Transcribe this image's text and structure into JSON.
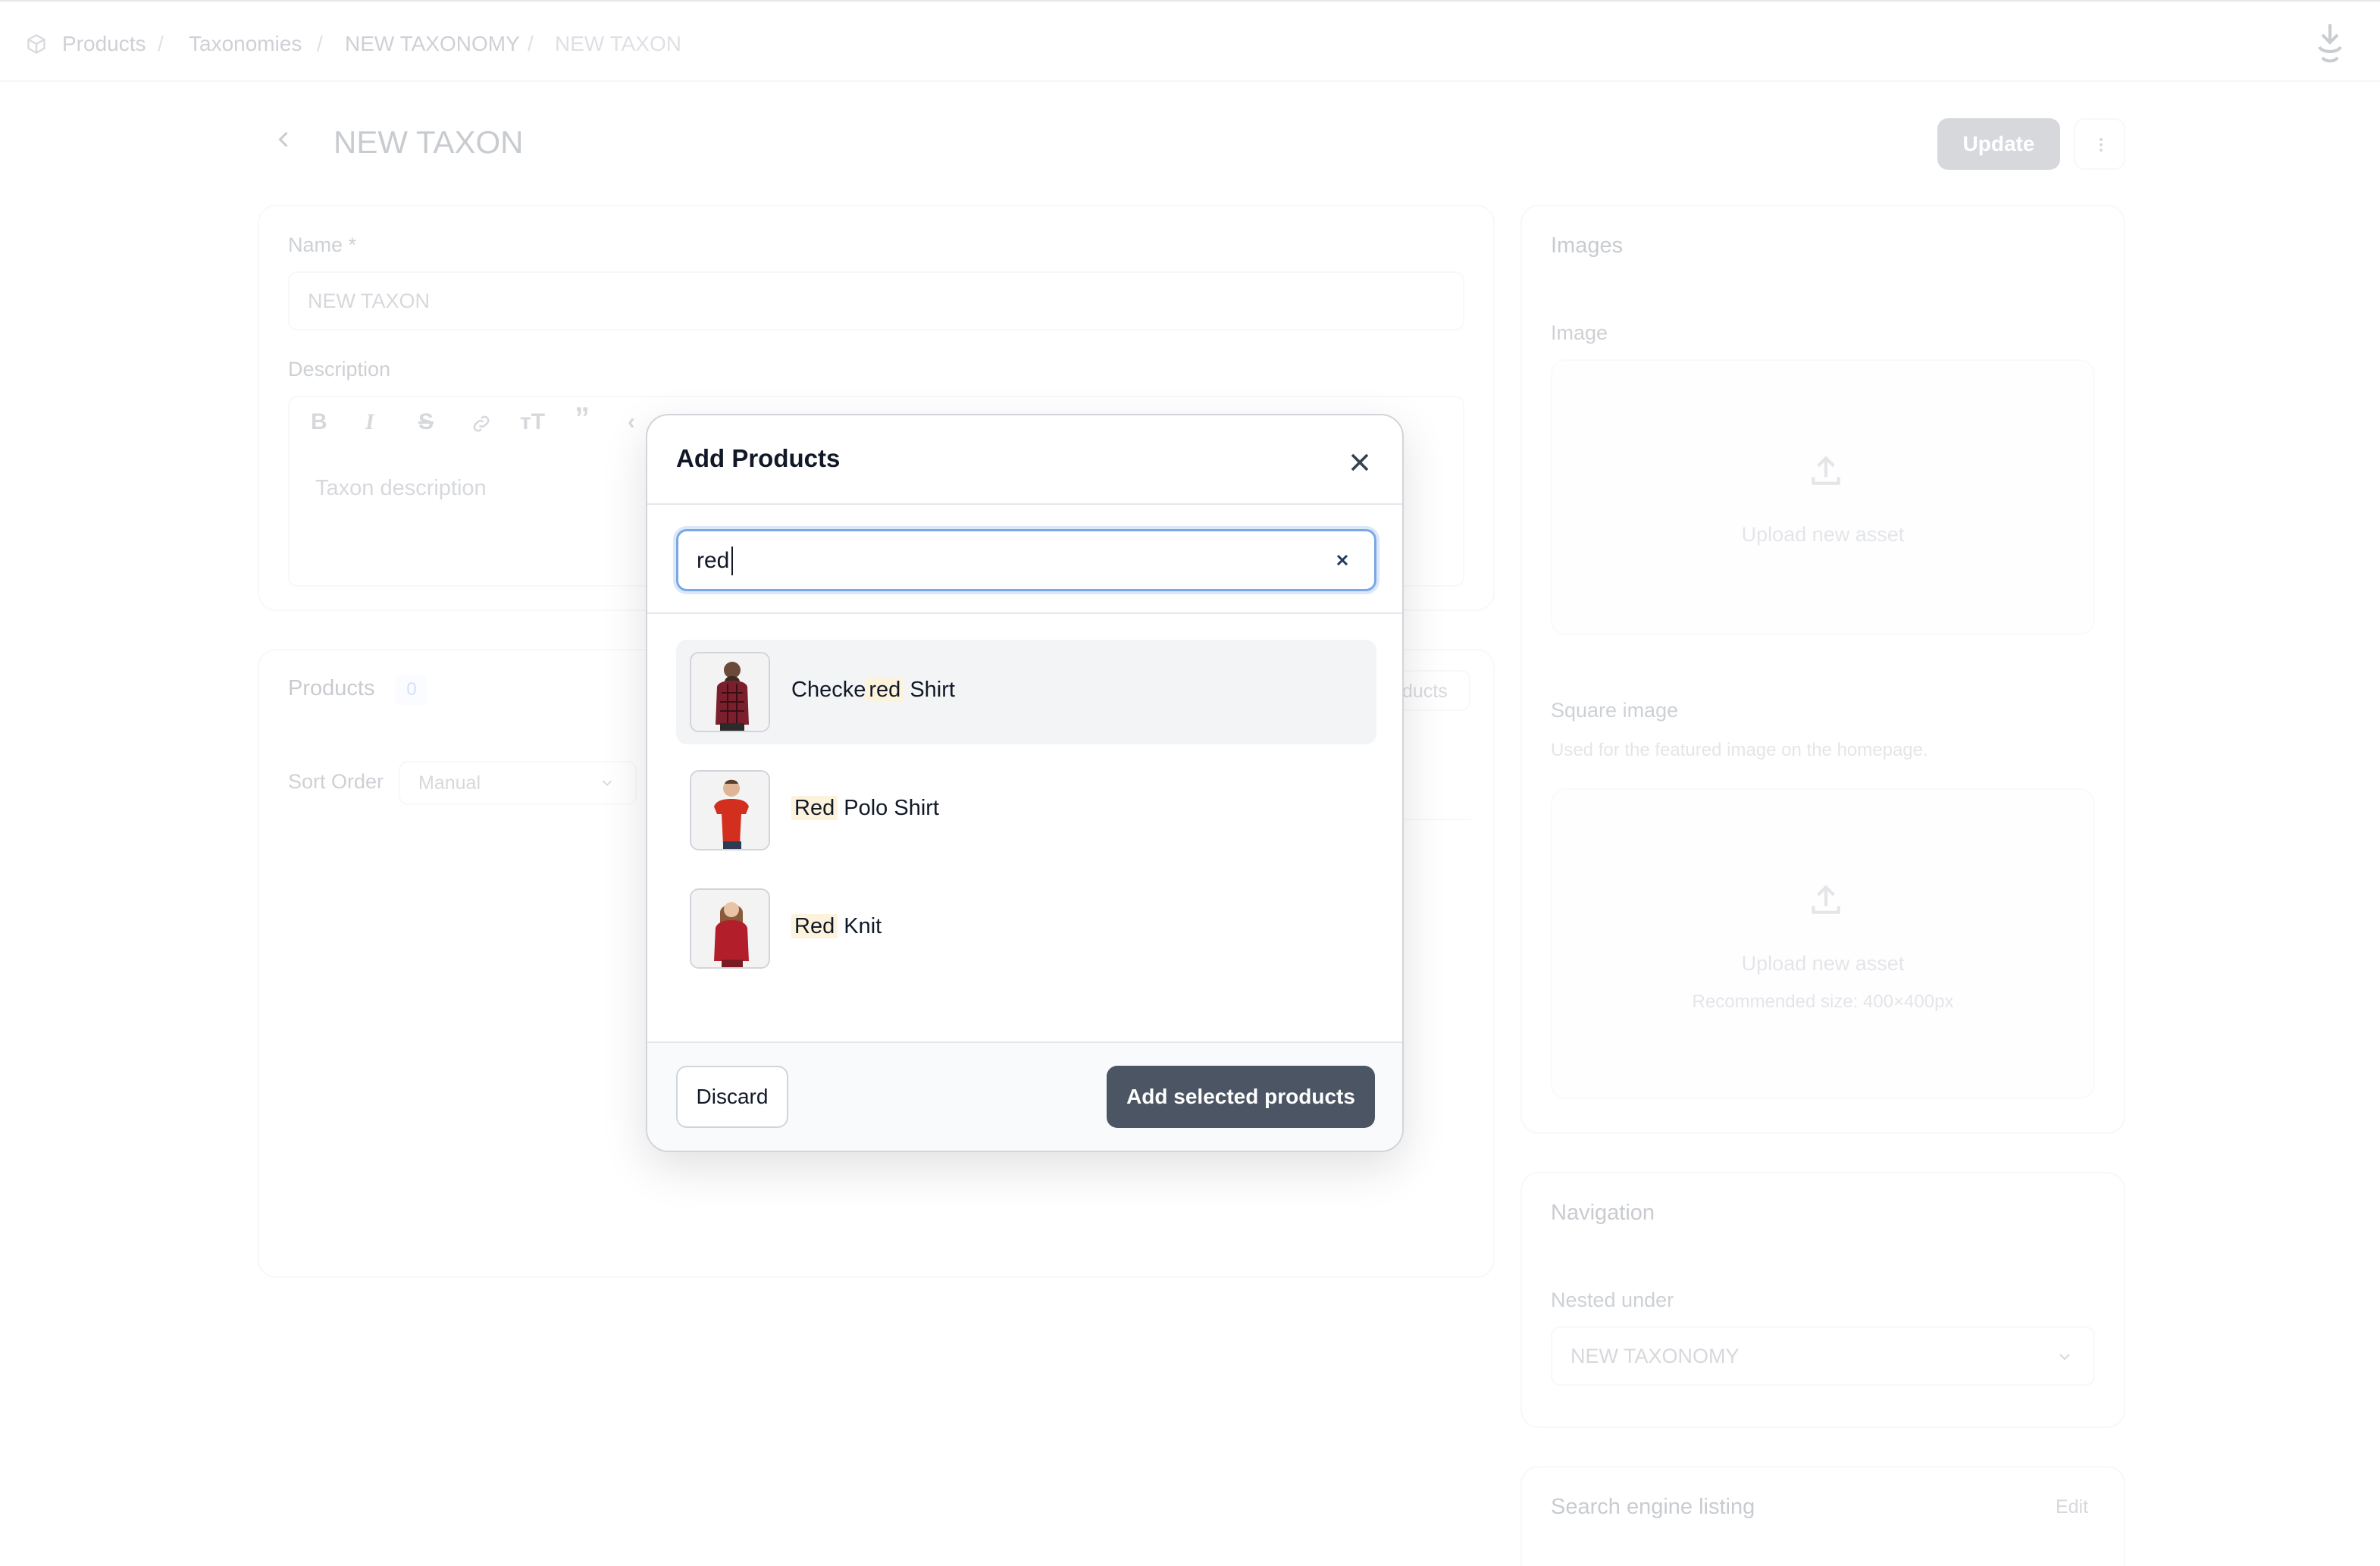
{
  "breadcrumb": {
    "items": [
      "Products",
      "Taxonomies",
      "NEW TAXONOMY",
      "NEW TAXON"
    ],
    "separator": "/"
  },
  "header": {
    "title": "NEW TAXON",
    "update_label": "Update"
  },
  "form": {
    "name_label": "Name *",
    "name_value": "NEW TAXON",
    "description_label": "Description",
    "description_placeholder": "Taxon description",
    "toolbar_icons": [
      "bold-icon",
      "italic-icon",
      "strikethrough-icon",
      "link-icon",
      "text-size-icon",
      "quote-icon",
      "code-icon"
    ]
  },
  "products_card": {
    "title": "Products",
    "count": "0",
    "add_button_fragment": "ducts",
    "sort_label": "Sort Order",
    "sort_value": "Manual"
  },
  "images_card": {
    "title": "Images",
    "image_label": "Image",
    "upload_text": "Upload new asset",
    "square_label": "Square image",
    "square_hint": "Used for the featured image on the homepage.",
    "square_upload_text": "Upload new asset",
    "square_recommended": "Recommended size: 400×400px"
  },
  "navigation_card": {
    "title": "Navigation",
    "nested_label": "Nested under",
    "nested_value": "NEW TAXONOMY"
  },
  "seo_card": {
    "title": "Search engine listing",
    "edit_label": "Edit"
  },
  "modal": {
    "title": "Add Products",
    "search_value": "red",
    "results": [
      {
        "parts": [
          "Checke",
          "red",
          "Shirt"
        ],
        "highlight": [
          false,
          true,
          false
        ],
        "active": true
      },
      {
        "parts": [
          "Red",
          "Polo Shirt"
        ],
        "highlight": [
          true,
          false
        ],
        "active": false
      },
      {
        "parts": [
          "Red",
          "Knit"
        ],
        "highlight": [
          true,
          false
        ],
        "active": false
      }
    ],
    "discard_label": "Discard",
    "add_label": "Add selected products"
  },
  "colors": {
    "primary_button": "#4b5563",
    "focus_ring": "#7aa7e6",
    "highlight": "#fdf3dc"
  }
}
